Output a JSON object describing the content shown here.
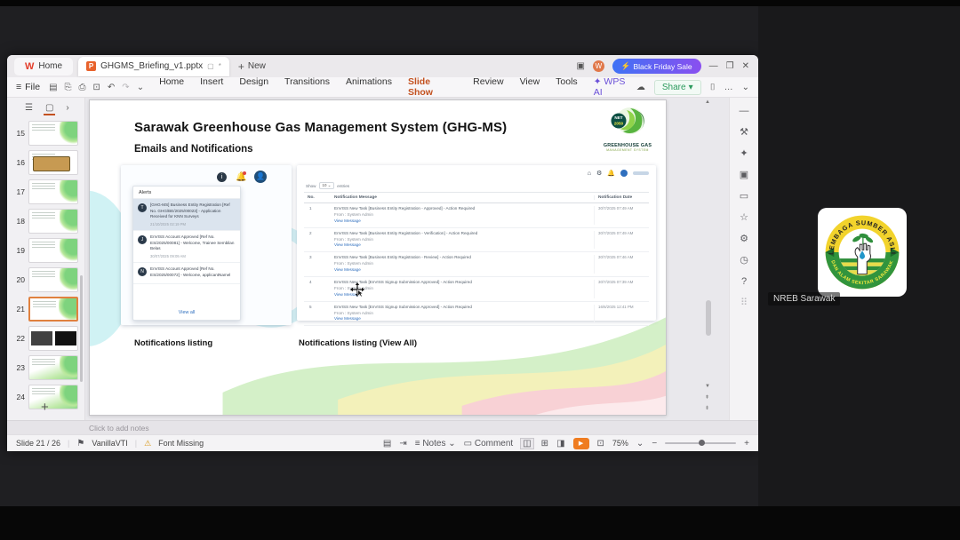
{
  "window": {
    "tabs": {
      "home_label": "Home",
      "document_title": "GHGMS_Briefing_v1.pptx",
      "modified_mark": "*",
      "new_label": "New",
      "promo_label": "Black Friday Sale"
    },
    "menubar": {
      "file_label": "File",
      "items": [
        "Home",
        "Insert",
        "Design",
        "Transitions",
        "Animations",
        "Slide Show",
        "Review",
        "View",
        "Tools",
        "WPS AI"
      ],
      "active_item": "Slide Show",
      "share_label": "Share"
    },
    "notes_placeholder": "Click to add notes",
    "status": {
      "slide_info": "Slide 21 / 26",
      "theme_name": "VanillaVTI",
      "font_warning": "Font Missing",
      "notes_label": "Notes",
      "comment_label": "Comment",
      "zoom_level": "75%"
    }
  },
  "thumbnail_panel": {
    "slides": [
      {
        "num": "15",
        "variant": "green",
        "selected": false
      },
      {
        "num": "16",
        "variant": "tan",
        "selected": false
      },
      {
        "num": "17",
        "variant": "green",
        "selected": false
      },
      {
        "num": "18",
        "variant": "green",
        "selected": false
      },
      {
        "num": "19",
        "variant": "green",
        "selected": false
      },
      {
        "num": "20",
        "variant": "green",
        "selected": false
      },
      {
        "num": "21",
        "variant": "green",
        "selected": true
      },
      {
        "num": "22",
        "variant": "dark",
        "selected": false
      },
      {
        "num": "23",
        "variant": "green2",
        "selected": false
      },
      {
        "num": "24",
        "variant": "green2",
        "selected": false
      }
    ],
    "add_label": "+"
  },
  "slide": {
    "title": "Sarawak Greenhouse Gas Management System (GHG-MS)",
    "subtitle": "Emails and Notifications",
    "logo": {
      "badge_top": "NET",
      "badge_bottom": "2050",
      "name_line1": "GREENHOUSE GAS",
      "name_line2": "MANAGEMENT SYSTEM"
    },
    "alerts_popup": {
      "header": "Alerts",
      "view_all": "View all",
      "items": [
        {
          "initial": "T",
          "text": "[GHG-MS] Business Entity Registration [Ref No. GHG/BE/2025/00023] - Application Received for KNN Surveys",
          "time": "21/10/2025 02:19 PM",
          "highlighted": true
        },
        {
          "initial": "J",
          "text": "EnVISS Account Approved [Ref No. ES/2025/00081] - Welcome, Trainee Sembilan Belas",
          "time": "30/07/2025 09:09 AM",
          "highlighted": false
        },
        {
          "initial": "N",
          "text": "EnVISS Account Approved [Ref No. ES/2025/00072] - Welcome, applicantNamel",
          "time": "",
          "highlighted": false
        }
      ]
    },
    "notifications_table": {
      "show_label": "Show",
      "show_value": "10",
      "entries_label": "entries",
      "columns": [
        "No.",
        "Notification Message",
        "Notification Date"
      ],
      "from_line": "From : System Admin",
      "link_label": "View Message",
      "rows": [
        {
          "no": "1",
          "message": "EnVISS New Task [Business Entity Registration - Approved] - Action Required",
          "date": "30/7/2025 07:49 AM"
        },
        {
          "no": "2",
          "message": "EnVISS New Task [Business Entity Registration - Verification] - Action Required",
          "date": "30/7/2025 07:49 AM"
        },
        {
          "no": "3",
          "message": "EnVISS New Task [Business Entity Registration - Review] - Action Required",
          "date": "30/7/2025 07:46 AM"
        },
        {
          "no": "4",
          "message": "EnVISS New Task [EnVISS Signup Submission Approved] - Action Required",
          "date": "30/7/2025 07:39 AM"
        },
        {
          "no": "5",
          "message": "EnVISS New Task [EnVISS Signup Submission Approved] - Action Required",
          "date": "16/6/2025 12:41 PM"
        }
      ]
    },
    "captions": {
      "left": "Notifications listing",
      "right": "Notifications listing (View All)"
    }
  },
  "right_toolbar": {
    "icons": [
      {
        "name": "collapse-icon",
        "glyph": "—",
        "dim": false
      },
      {
        "name": "tools-icon",
        "glyph": "⚒",
        "dim": false
      },
      {
        "name": "effects-icon",
        "glyph": "✦",
        "dim": false
      },
      {
        "name": "shapes-icon",
        "glyph": "▣",
        "dim": false
      },
      {
        "name": "comment-panel-icon",
        "glyph": "▭",
        "dim": false
      },
      {
        "name": "favorites-icon",
        "glyph": "☆",
        "dim": false
      },
      {
        "name": "settings-icon",
        "glyph": "⚙",
        "dim": false
      },
      {
        "name": "history-icon",
        "glyph": "◷",
        "dim": false
      },
      {
        "name": "help-icon",
        "glyph": "?",
        "dim": false
      },
      {
        "name": "apps-grid-icon",
        "glyph": "⠿",
        "dim": true
      }
    ]
  },
  "video_overlay": {
    "participant_name": "NREB Sarawak",
    "emblem": {
      "arc_top": "LEMBAGA SUMBER ASLI",
      "arc_bottom": "DAN ALAM SEKITAR SARAWAK"
    }
  },
  "colors": {
    "accent_orange": "#c3511f",
    "promo_gradient_start": "#3f72f5",
    "promo_gradient_end": "#8a4ff0",
    "share_green": "#2c9a5d",
    "link_blue": "#2f6fbe",
    "play_orange": "#ef7c20",
    "alert_highlight": "#dbe4ee"
  }
}
